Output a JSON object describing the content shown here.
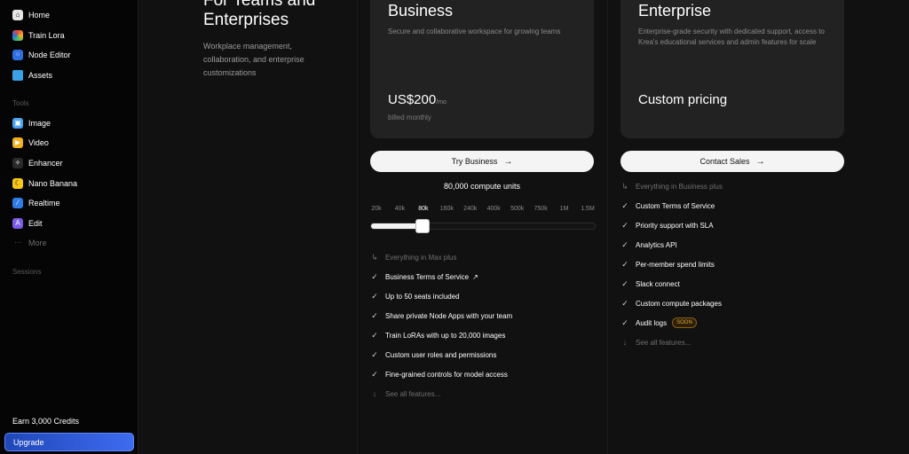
{
  "sidebar": {
    "items": [
      {
        "label": "Home",
        "icon": "home-icon",
        "color": "#e6e6e6"
      },
      {
        "label": "Train Lora",
        "icon": "train-lora-icon",
        "color": "#e94b3c"
      },
      {
        "label": "Node Editor",
        "icon": "node-editor-icon",
        "color": "#2f6fe0"
      },
      {
        "label": "Assets",
        "icon": "folder-icon",
        "color": "#3aa0e8"
      }
    ],
    "tools_label": "Tools",
    "tools": [
      {
        "label": "Image",
        "icon": "image-icon",
        "color": "#4aa3f0"
      },
      {
        "label": "Video",
        "icon": "video-icon",
        "color": "#f2b01e"
      },
      {
        "label": "Enhancer",
        "icon": "enhancer-icon",
        "color": "#2a2a2a"
      },
      {
        "label": "Nano Banana",
        "icon": "banana-icon",
        "color": "#f5c518"
      },
      {
        "label": "Realtime",
        "icon": "realtime-icon",
        "color": "#2f7ce8"
      },
      {
        "label": "Edit",
        "icon": "edit-icon",
        "color": "#7b5ce6"
      }
    ],
    "more_label": "More",
    "sessions_label": "Sessions",
    "earn_label": "Earn 3,000 Credits",
    "upgrade_label": "Upgrade"
  },
  "intro": {
    "title": "For Teams and Enterprises",
    "description": "Workplace management, collaboration, and enterprise customizations"
  },
  "business": {
    "title": "Business",
    "description": "Secure and collaborative workspace for growing teams",
    "price": "US$200",
    "price_unit": "/mo",
    "billed": "billed monthly",
    "cta": "Try Business",
    "compute_units": "80,000 compute units",
    "slider_ticks": [
      "20k",
      "40k",
      "80k",
      "160k",
      "240k",
      "400k",
      "500k",
      "750k",
      "1M",
      "1.5M"
    ],
    "slider_selected": "80k",
    "slider_value_fraction": 0.23,
    "includes": "Everything in Max plus",
    "features": [
      "Business Terms of Service",
      "Up to 50 seats included",
      "Share private Node Apps with your team",
      "Train LoRAs with up to 20,000 images",
      "Custom user roles and permissions",
      "Fine-grained controls for model access"
    ],
    "see_all": "See all features..."
  },
  "enterprise": {
    "title": "Enterprise",
    "description": "Enterprise-grade security with dedicated support, access to Krea's educational services and admin features for scale",
    "price": "Custom pricing",
    "cta": "Contact Sales",
    "includes": "Everything in Business plus",
    "features": [
      "Custom Terms of Service",
      "Priority support with SLA",
      "Analytics API",
      "Per-member spend limits",
      "Slack connect",
      "Custom compute packages",
      "Audit logs"
    ],
    "soon_badge": "SOON",
    "see_all": "See all features..."
  },
  "colors": {
    "background": "#111111",
    "sidebar": "#050505",
    "card": "#222222",
    "upgrade_accent": "#3e6cf0",
    "badge": "#e8a93a"
  }
}
